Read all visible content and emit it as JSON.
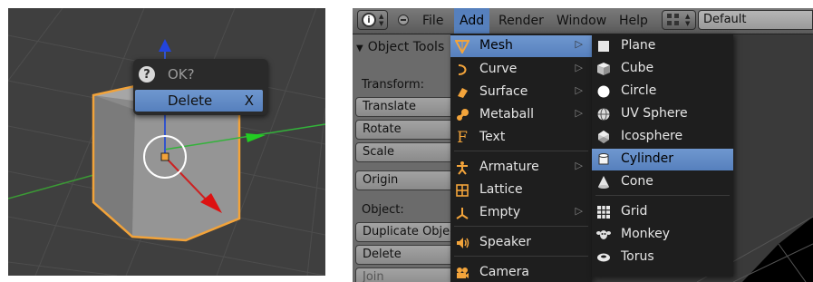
{
  "left_panel": {
    "popup": {
      "title": "OK?",
      "question_icon_glyph": "?",
      "item_label": "Delete",
      "item_shortcut": "X"
    }
  },
  "right_panel": {
    "header": {
      "info_icon_glyph": "i",
      "menus": [
        "File",
        "Add",
        "Render",
        "Window",
        "Help"
      ],
      "active_menu": "Add",
      "screen_layout": "Default"
    },
    "tool_shelf": {
      "title": "Object Tools",
      "transform_label": "Transform:",
      "buttons": [
        "Translate",
        "Rotate",
        "Scale",
        "Origin"
      ],
      "object_label": "Object:",
      "object_buttons": [
        "Duplicate Objects",
        "Delete",
        "Join"
      ]
    },
    "add_menu": {
      "items": [
        {
          "label": "Mesh",
          "icon": "mesh-icon",
          "submenu": true,
          "highlighted": true
        },
        {
          "label": "Curve",
          "icon": "curve-icon",
          "submenu": true
        },
        {
          "label": "Surface",
          "icon": "surface-icon",
          "submenu": true
        },
        {
          "label": "Metaball",
          "icon": "metaball-icon",
          "submenu": true
        },
        {
          "label": "Text",
          "icon": "text-icon",
          "submenu": false
        },
        {
          "label": "Armature",
          "icon": "armature-icon",
          "submenu": true
        },
        {
          "label": "Lattice",
          "icon": "lattice-icon",
          "submenu": false
        },
        {
          "label": "Empty",
          "icon": "empty-icon",
          "submenu": true
        },
        {
          "label": "Speaker",
          "icon": "speaker-icon",
          "submenu": false
        },
        {
          "label": "Camera",
          "icon": "camera-icon",
          "submenu": false
        }
      ]
    },
    "mesh_menu": {
      "items": [
        {
          "label": "Plane",
          "icon": "plane-icon"
        },
        {
          "label": "Cube",
          "icon": "cube-icon"
        },
        {
          "label": "Circle",
          "icon": "circle-icon"
        },
        {
          "label": "UV Sphere",
          "icon": "uv-sphere-icon"
        },
        {
          "label": "Icosphere",
          "icon": "icosphere-icon"
        },
        {
          "label": "Cylinder",
          "icon": "cylinder-icon",
          "highlighted": true
        },
        {
          "label": "Cone",
          "icon": "cone-icon"
        },
        {
          "label": "Grid",
          "icon": "grid-icon"
        },
        {
          "label": "Monkey",
          "icon": "monkey-icon"
        },
        {
          "label": "Torus",
          "icon": "torus-icon"
        }
      ]
    }
  },
  "colors": {
    "selection_blue": "#5680bd",
    "menu_bg": "#1e1e1e",
    "viewport_bg": "#3f3f3f",
    "object_outline": "#f2a33a"
  }
}
